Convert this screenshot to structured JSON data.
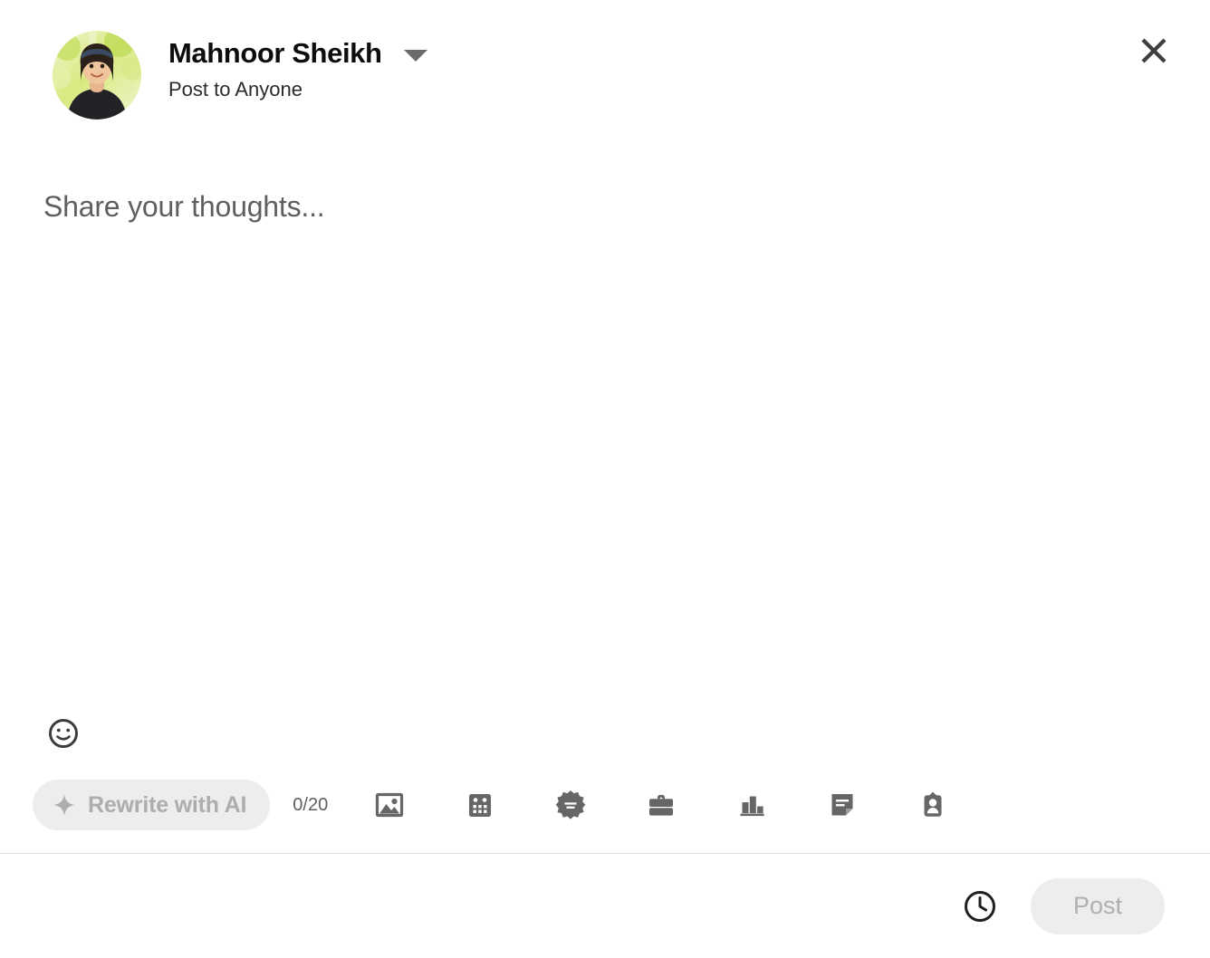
{
  "header": {
    "user_name": "Mahnoor Sheikh",
    "audience": "Post to Anyone",
    "avatar_alt": "profile-photo",
    "dropdown_icon": "chevron-down-icon",
    "close_icon": "close-icon"
  },
  "editor": {
    "placeholder": "Share your thoughts...",
    "value": "",
    "emoji_icon": "emoji-smiley-icon"
  },
  "toolbar": {
    "ai_button_label": "Rewrite with AI",
    "ai_button_icon": "sparkle-icon",
    "char_counter": "0/20",
    "icons": [
      {
        "name": "image-icon",
        "label": "Add media"
      },
      {
        "name": "calendar-icon",
        "label": "Create an event"
      },
      {
        "name": "celebrate-badge-icon",
        "label": "Celebrate an occasion"
      },
      {
        "name": "briefcase-icon",
        "label": "Share that you're hiring"
      },
      {
        "name": "poll-bar-chart-icon",
        "label": "Create a poll"
      },
      {
        "name": "document-icon",
        "label": "Add a document"
      },
      {
        "name": "id-card-icon",
        "label": "Find an expert"
      }
    ]
  },
  "footer": {
    "schedule_icon": "clock-icon",
    "post_label": "Post"
  },
  "colors": {
    "background": "#ffffff",
    "text_primary": "#0d0d0d",
    "text_secondary": "#2b2b2b",
    "text_muted": "#5f5f5f",
    "icon_grey": "#666666",
    "pill_background": "#ededed",
    "pill_text_disabled": "#b0b0b0",
    "divider": "#e4e4e4"
  }
}
